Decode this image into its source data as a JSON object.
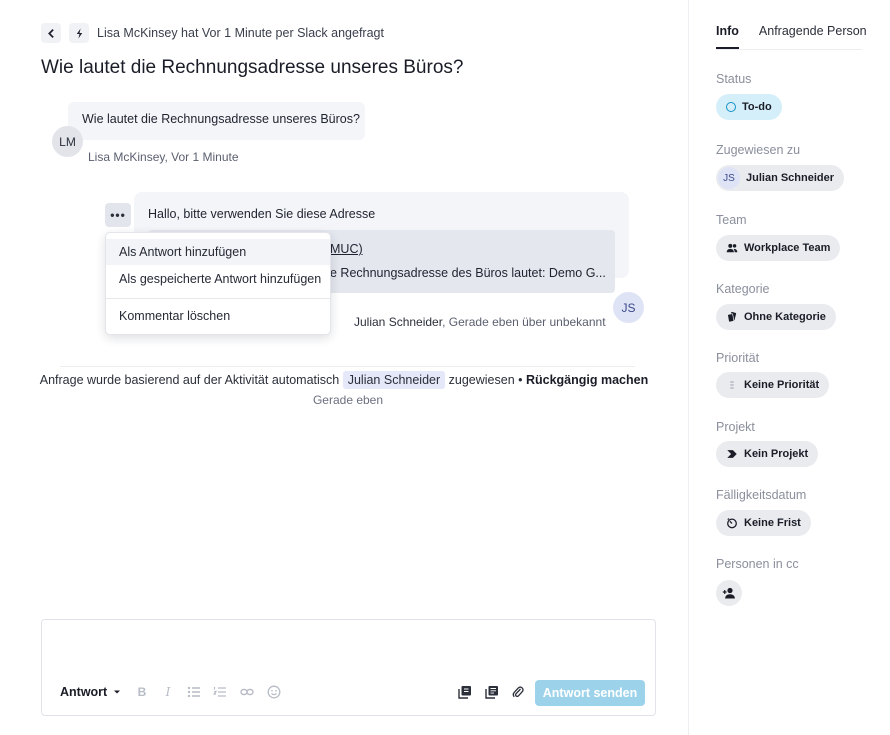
{
  "header": {
    "request_line": "Lisa McKinsey hat Vor 1 Minute per Slack angefragt",
    "title": "Wie lautet die Rechnungsadresse unseres Büros?"
  },
  "question": {
    "text": "Wie lautet die Rechnungsadresse unseres Büros?",
    "avatar": "LM",
    "author": "Lisa McKinsey",
    "time": ", Vor 1 Minute"
  },
  "answer": {
    "text": "Hallo, bitte verwenden Sie diese Adresse",
    "quote_line1": "MUC)",
    "quote_line2": "e Rechnungsadresse des Büros lautet: Demo G...",
    "avatar": "JS",
    "author": "Julian Schneider",
    "time": ", Gerade eben über unbekannt",
    "more_label": "•••"
  },
  "context_menu": {
    "items": [
      "Als Antwort hinzufügen",
      "Als gespeicherte Antwort hinzufügen",
      "Kommentar löschen"
    ]
  },
  "system_event": {
    "prefix": "Anfrage wurde basierend auf der Aktivität automatisch",
    "assignee": "Julian Schneider",
    "suffix": "zugewiesen •",
    "undo": "Rückgängig machen",
    "time": "Gerade eben"
  },
  "composer": {
    "reply_type": "Antwort",
    "send_label": "Antwort senden",
    "send_color": "#9dd3ea"
  },
  "sidebar": {
    "tabs": [
      "Info",
      "Anfragende Person"
    ],
    "status": {
      "label": "Status",
      "value": "To-do",
      "color": "#1592c9"
    },
    "assigned": {
      "label": "Zugewiesen zu",
      "avatar": "JS",
      "value": "Julian Schneider"
    },
    "team": {
      "label": "Team",
      "value": "Workplace Team"
    },
    "category": {
      "label": "Kategorie",
      "value": "Ohne Kategorie"
    },
    "priority": {
      "label": "Priorität",
      "value": "Keine Priorität"
    },
    "project": {
      "label": "Projekt",
      "value": "Kein Projekt"
    },
    "due": {
      "label": "Fälligkeitsdatum",
      "value": "Keine Frist"
    },
    "cc": {
      "label": "Personen in cc"
    }
  }
}
